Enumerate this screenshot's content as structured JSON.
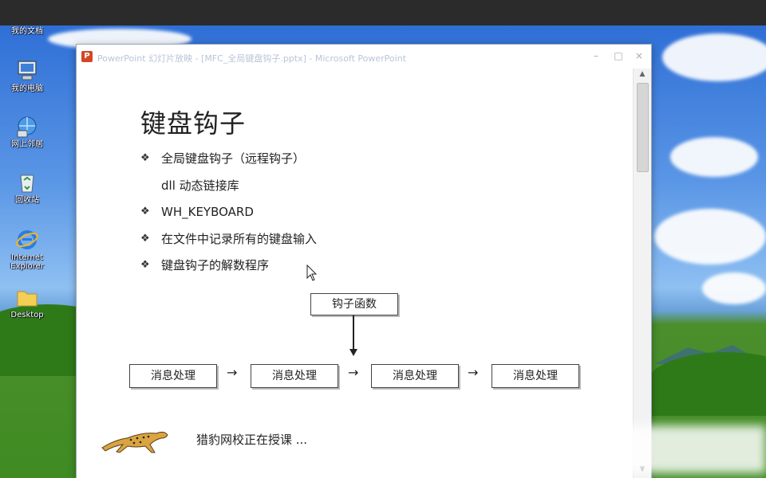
{
  "window": {
    "title": "PowerPoint 幻灯片放映 - [MFC_全局键盘钩子.pptx] - Microsoft PowerPoint",
    "minimize": "–",
    "maximize": "□",
    "close": "×",
    "app_icon_letter": "P"
  },
  "desktop": {
    "icons": [
      {
        "label": "我的文档"
      },
      {
        "label": "我的电脑"
      },
      {
        "label": "网上邻居"
      },
      {
        "label": "回收站"
      },
      {
        "label": "Internet Explorer"
      },
      {
        "label": "Desktop"
      }
    ]
  },
  "slide": {
    "title": "键盘钩子",
    "bullet_mark": "❖",
    "bullets": [
      "全局键盘钩子（远程钩子）",
      "dll 动态链接库",
      "WH_KEYBOARD",
      "在文件中记录所有的键盘输入",
      "键盘钩子的解数程序"
    ],
    "diagram": {
      "hook_box": "钩子函数",
      "process_boxes": [
        "消息处理",
        "消息处理",
        "消息处理",
        "消息处理"
      ],
      "arrow": "→"
    },
    "footer_text": "猎豹网校正在授课 ..."
  },
  "colors": {
    "title_text": "#b8c6d8",
    "powerpoint_red": "#d24726",
    "cheetah": "#d9a441"
  }
}
